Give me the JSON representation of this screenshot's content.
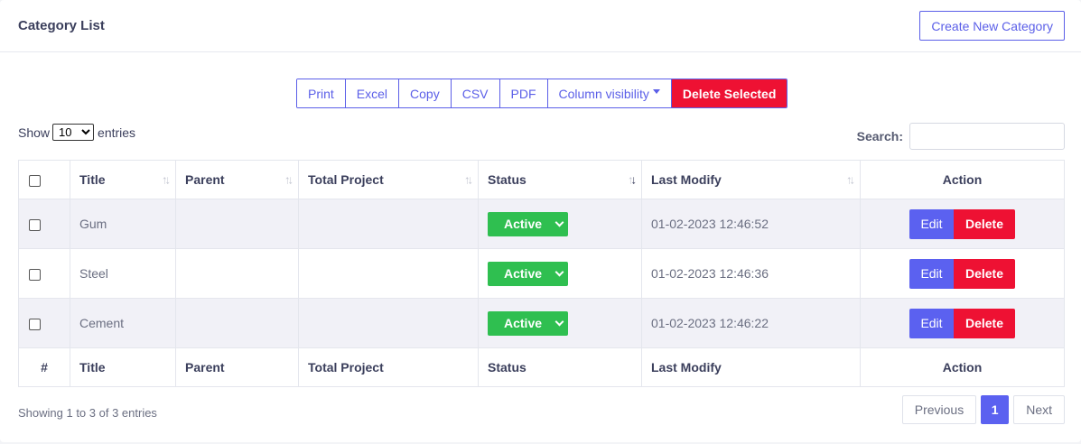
{
  "header": {
    "title": "Category List",
    "create_label": "Create New Category"
  },
  "toolbar": {
    "buttons": [
      "Print",
      "Excel",
      "Copy",
      "CSV",
      "PDF"
    ],
    "column_visibility": "Column visibility",
    "delete_selected": "Delete Selected"
  },
  "length": {
    "prefix": "Show",
    "value": "10",
    "suffix": "entries"
  },
  "search": {
    "label": "Search:",
    "value": ""
  },
  "table": {
    "columns": [
      "Title",
      "Parent",
      "Total Project",
      "Status",
      "Last Modify",
      "Action"
    ],
    "footer": [
      "#",
      "Title",
      "Parent",
      "Total Project",
      "Status",
      "Last Modify",
      "Action"
    ],
    "rows": [
      {
        "title": "Gum",
        "parent": "",
        "total_project": "",
        "status": "Active",
        "last_modify": "01-02-2023 12:46:52"
      },
      {
        "title": "Steel",
        "parent": "",
        "total_project": "",
        "status": "Active",
        "last_modify": "01-02-2023 12:46:36"
      },
      {
        "title": "Cement",
        "parent": "",
        "total_project": "",
        "status": "Active",
        "last_modify": "01-02-2023 12:46:22"
      }
    ],
    "edit_label": "Edit",
    "delete_label": "Delete"
  },
  "info": "Showing 1 to 3 of 3 entries",
  "pagination": {
    "previous": "Previous",
    "current": "1",
    "next": "Next"
  },
  "colors": {
    "accent": "#5b61f0",
    "danger": "#ee1133",
    "success": "#2fbf50"
  }
}
